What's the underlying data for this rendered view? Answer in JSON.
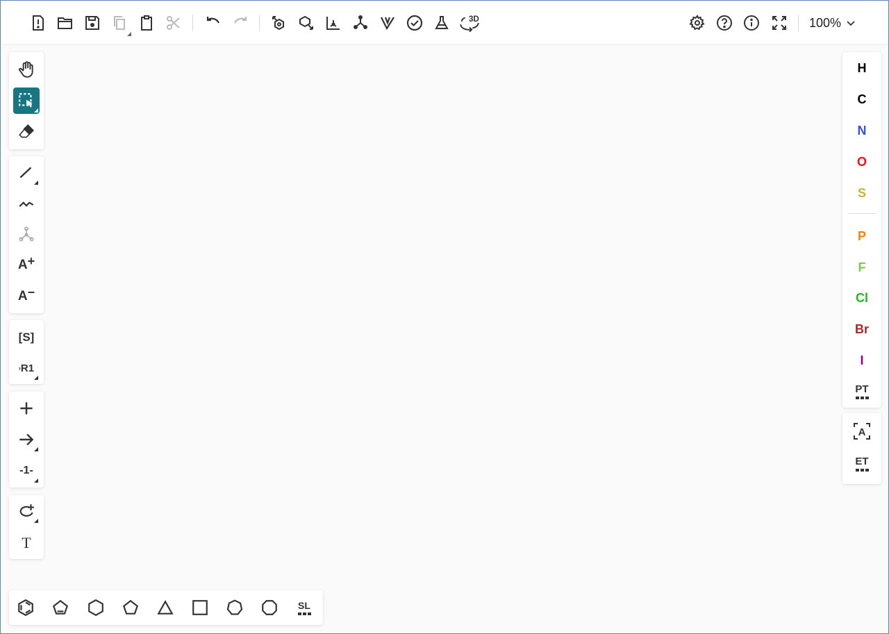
{
  "toolbar": {
    "zoom_value": "100%",
    "three_d_label": "3D"
  },
  "left_tools": {
    "charge_plus_label": "A",
    "charge_minus_label": "A",
    "sgroup_label": "[S]",
    "rgroup_label": "R1",
    "mapping_label": "-1-",
    "text_label": "T"
  },
  "atoms": [
    {
      "symbol": "H",
      "color": "#000000"
    },
    {
      "symbol": "C",
      "color": "#000000"
    },
    {
      "symbol": "N",
      "color": "#304ff7"
    },
    {
      "symbol": "O",
      "color": "#ff0d0d"
    },
    {
      "symbol": "S",
      "color": "#c9b037"
    },
    {
      "symbol": "P",
      "color": "#ff8000"
    },
    {
      "symbol": "F",
      "color": "#78c950"
    },
    {
      "symbol": "Cl",
      "color": "#1fb81f"
    },
    {
      "symbol": "Br",
      "color": "#a62929"
    },
    {
      "symbol": "I",
      "color": "#940094"
    }
  ],
  "right_extra": {
    "periodic_label": "PT",
    "any_atom_label": "A",
    "extended_label": "ET"
  },
  "bottom": {
    "structure_library_label": "SL"
  },
  "colors": {
    "accent": "#167782",
    "icon": "#333333"
  }
}
